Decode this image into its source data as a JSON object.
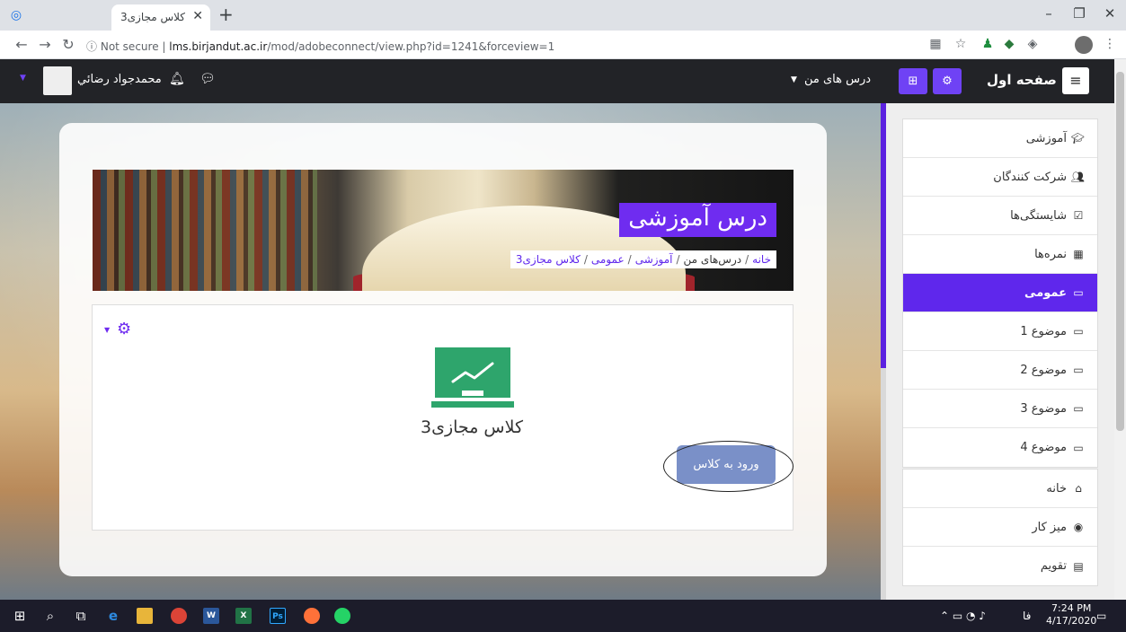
{
  "browser": {
    "tab_title": "کلاس مجازی3",
    "tab_close": "✕",
    "new_tab": "+",
    "url_secure_label": "Not secure",
    "url_host": "lms.birjandut.ac.ir",
    "url_path": "/mod/adobeconnect/view.php?id=1241&forceview=1"
  },
  "navbar": {
    "site_name": "صفحه اول",
    "my_courses": "درس های من",
    "user_name": "محمدجواد رضائي"
  },
  "course": {
    "title": "درس آموزشی",
    "breadcrumb": [
      "خانه",
      "درس‌های من",
      "آموزشی",
      "عمومی",
      "کلاس مجازی3"
    ]
  },
  "activity": {
    "name": "کلاس مجازی3",
    "enter_button": "ورود به کلاس"
  },
  "drawer": {
    "course_items": [
      {
        "label": "آموزشی",
        "icon": "graduation-cap-icon",
        "active": false
      },
      {
        "label": "شرکت کنندگان",
        "icon": "users-icon",
        "active": false
      },
      {
        "label": "شایستگی‌ها",
        "icon": "check-square-icon",
        "active": false
      },
      {
        "label": "نمره‌ها",
        "icon": "table-icon",
        "active": false
      },
      {
        "label": "عمومی",
        "icon": "folder-icon",
        "active": true
      },
      {
        "label": "موضوع 1",
        "icon": "folder-icon",
        "active": false
      },
      {
        "label": "موضوع 2",
        "icon": "folder-icon",
        "active": false
      },
      {
        "label": "موضوع 3",
        "icon": "folder-icon",
        "active": false
      },
      {
        "label": "موضوع 4",
        "icon": "folder-icon",
        "active": false
      }
    ],
    "site_items": [
      {
        "label": "خانه",
        "icon": "home-icon"
      },
      {
        "label": "میز کار",
        "icon": "dashboard-icon"
      },
      {
        "label": "تقویم",
        "icon": "calendar-icon"
      }
    ]
  },
  "taskbar": {
    "lang": "فا",
    "time": "7:24 PM",
    "date": "4/17/2020"
  },
  "colors": {
    "accent": "#6f2cf0",
    "navbar": "#222327",
    "activity_green": "#2ea56c"
  }
}
